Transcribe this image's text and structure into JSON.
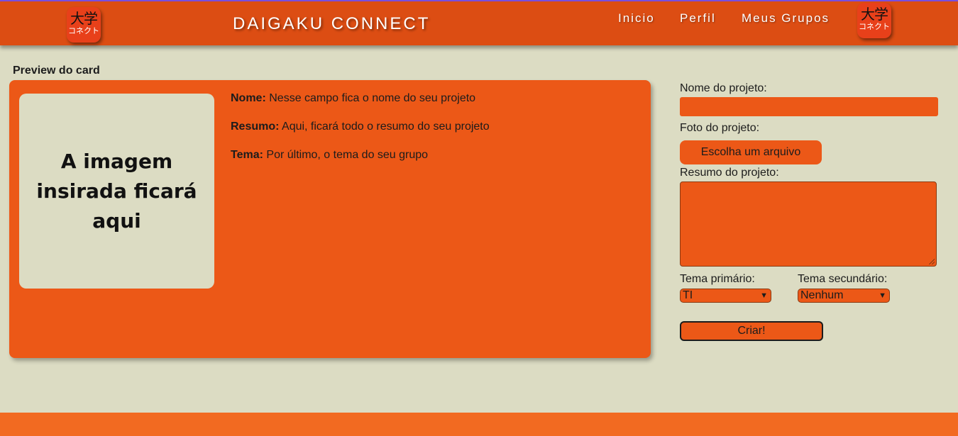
{
  "header": {
    "brand": "DAIGAKU CONNECT",
    "logo": {
      "kanji": "大学",
      "kana": "コネクト"
    },
    "nav": [
      "Inicio",
      "Perfil",
      "Meus Grupos"
    ]
  },
  "preview": {
    "label": "Preview do card",
    "image_placeholder": "A imagem insirada ficará aqui",
    "fields": [
      {
        "key": "Nome:",
        "value": "Nesse campo fica o nome do seu projeto"
      },
      {
        "key": "Resumo:",
        "value": "Aqui, ficará todo o resumo do seu projeto"
      },
      {
        "key": "Tema:",
        "value": "Por último, o tema do seu grupo"
      }
    ]
  },
  "form": {
    "name_label": "Nome do projeto:",
    "name_value": "",
    "photo_label": "Foto do projeto:",
    "file_button": "Escolha um arquivo",
    "summary_label": "Resumo do projeto:",
    "summary_value": "",
    "primary_theme_label": "Tema primário:",
    "primary_theme_value": "TI",
    "secondary_theme_label": "Tema secundário:",
    "secondary_theme_value": "Nenhum",
    "submit": "Criar!"
  },
  "colors": {
    "header": "#dc4d13",
    "accent": "#ec5817",
    "background": "#dcdcc3",
    "footer": "#f26a21"
  }
}
